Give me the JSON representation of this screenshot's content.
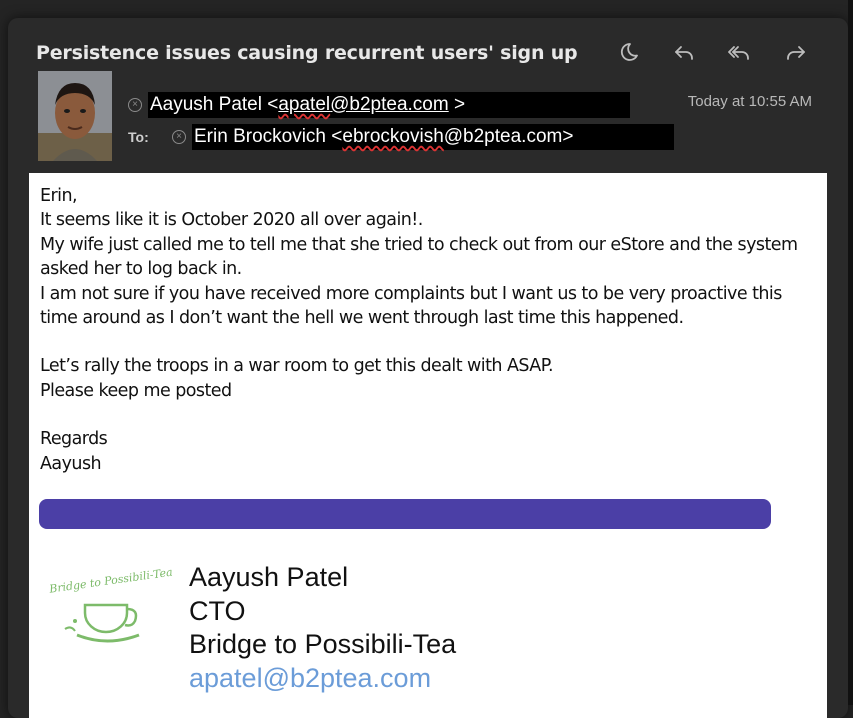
{
  "email": {
    "subject": "Persistence issues causing recurrent users' sign up",
    "from": {
      "prefix": "Aayush Patel <",
      "email_user": "apatel",
      "email_domain": "@b2ptea.com",
      "suffix": " >"
    },
    "to_label": "To:",
    "to": {
      "prefix": "Erin Brockovich <",
      "email_user": "ebrockovish",
      "email_domain": "@b2ptea.com",
      "suffix": ">"
    },
    "timestamp": "Today at 10:55 AM",
    "body": {
      "greeting": "Erin,",
      "line1": "It seems like it is October 2020 all over again!.",
      "line2": "My wife just called me to tell me that she tried to check out from our eStore and the system asked her to log back in.",
      "line3": "I am not sure if you have received more complaints but I want us to be very proactive this time around as I don’t want the hell we went through last time this happened.",
      "line4": "Let’s rally the troops in a war room to get this dealt with ASAP.",
      "line5": "Please keep me posted",
      "closing": "Regards",
      "sign_name": "Aayush"
    },
    "signature": {
      "name": "Aayush Patel",
      "title": "CTO",
      "company": "Bridge to Possibili-Tea",
      "email": "apatel@b2ptea.com",
      "logo_text": "Bridge to Possibili-Tea"
    }
  },
  "toolbar": {
    "icons": [
      "moon-icon",
      "reply-icon",
      "reply-all-icon",
      "forward-icon"
    ]
  },
  "colors": {
    "accent_bar": "#4b3fa6",
    "sig_email": "#6b9cd8",
    "logo_green": "#7dbb6a"
  }
}
